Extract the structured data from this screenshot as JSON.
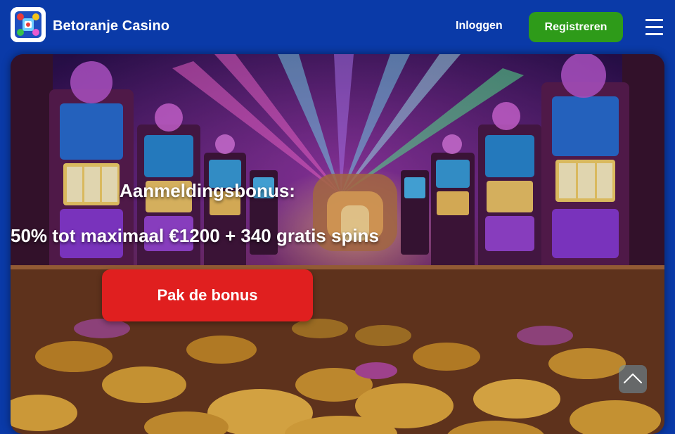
{
  "header": {
    "brand_name": "Betoranje Casino",
    "login_label": "Inloggen",
    "register_label": "Registreren",
    "logo_icon": "casino-logo-icon",
    "menu_icon": "hamburger-menu-icon"
  },
  "hero": {
    "bonus_label": "Aanmeldingsbonus:",
    "bonus_offer": "50% tot maximaal €1200 + 340 gratis spins",
    "cta_label": "Pak de bonus",
    "scroll_top_icon": "chevron-up-icon"
  },
  "colors": {
    "header_bg": "#0a3aa8",
    "register_button": "#2e9b19",
    "cta_button": "#e01f1f",
    "text": "#ffffff"
  }
}
